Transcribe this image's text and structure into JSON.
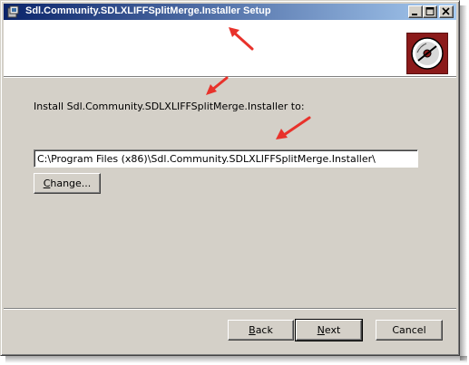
{
  "window": {
    "title": "Sdl.Community.SDLXLIFFSplitMerge.Installer Setup",
    "caption_buttons": [
      "minimize-icon",
      "maximize-icon",
      "close-icon"
    ]
  },
  "banner": {
    "logo_icon": "cd-disc-icon",
    "logo_color": "#8b1a1a"
  },
  "content": {
    "install_label": "Install Sdl.Community.SDLXLIFFSplitMerge.Installer to:",
    "install_path": "C:\\Program Files (x86)\\Sdl.Community.SDLXLIFFSplitMerge.Installer\\",
    "change_button": {
      "accel": "C",
      "rest": "hange..."
    }
  },
  "footer": {
    "back_button": {
      "accel": "B",
      "rest": "ack"
    },
    "next_button": {
      "accel": "N",
      "rest": "ext"
    },
    "cancel_button": "Cancel"
  },
  "annotations": {
    "arrow_color": "#e8322b",
    "count": 4
  },
  "colors": {
    "titlebar_start": "#0a246a",
    "titlebar_end": "#a6caf0",
    "dialog_bg": "#d4d0c8"
  }
}
